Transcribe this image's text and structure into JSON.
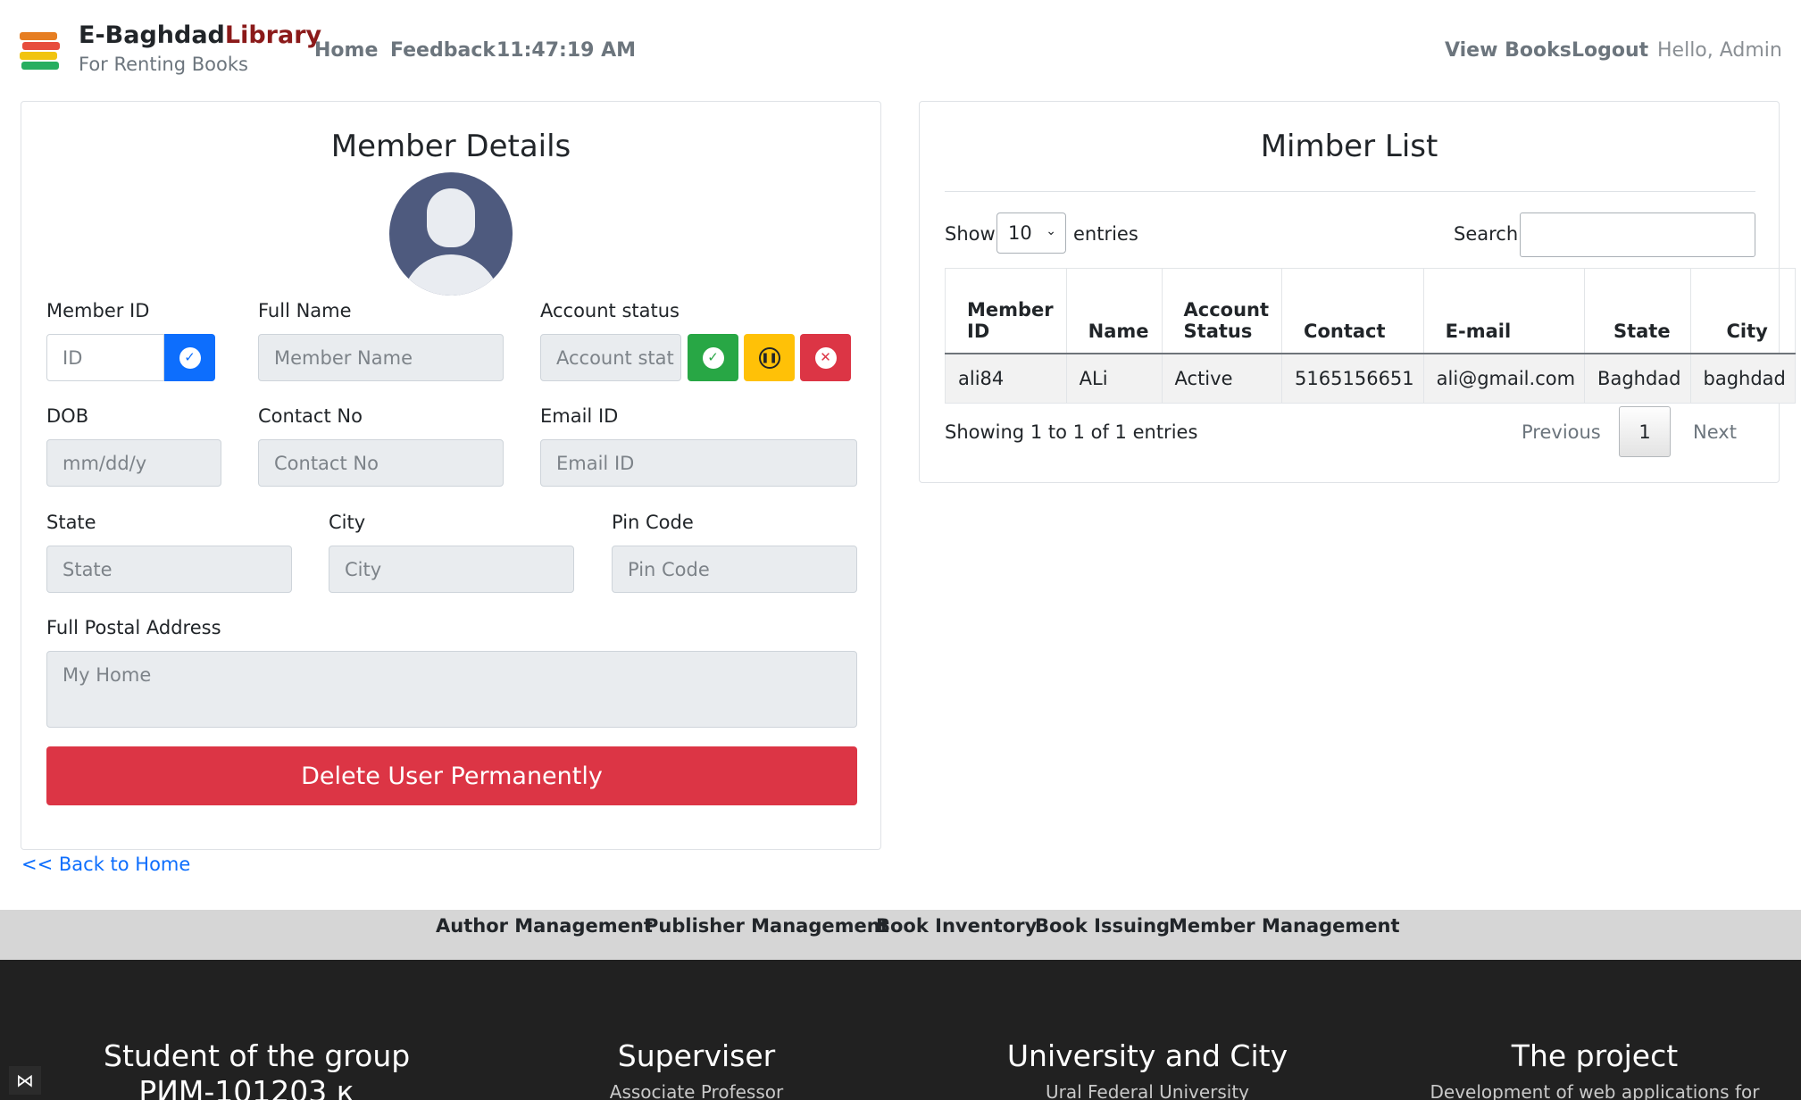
{
  "brand": {
    "name_main": "E-Baghdad",
    "name_accent": "Library",
    "tagline": "For Renting Books",
    "logo_icon": "books-stack-icon"
  },
  "nav": {
    "home": "Home",
    "feedback": "Feedback",
    "clock": "11:47:19 AM",
    "view_books": "View Books",
    "logout": "Logout",
    "greeting": "Hello, Admin"
  },
  "member_details": {
    "title": "Member Details",
    "avatar_icon": "user-avatar-icon",
    "member_id_label": "Member ID",
    "member_id_placeholder": "ID",
    "full_name_label": "Full Name",
    "full_name_placeholder": "Member Name",
    "account_status_label": "Account status",
    "account_status_placeholder": "Account stat",
    "dob_label": "DOB",
    "dob_placeholder": "mm/dd/y",
    "contact_label": "Contact No",
    "contact_placeholder": "Contact No",
    "email_label": "Email ID",
    "email_placeholder": "Email ID",
    "state_label": "State",
    "state_placeholder": "State",
    "city_label": "City",
    "city_placeholder": "City",
    "pin_label": "Pin Code",
    "pin_placeholder": "Pin Code",
    "address_label": "Full Postal Address",
    "address_placeholder": "My Home",
    "delete_button": "Delete User Permanently",
    "back_link": "<< Back to Home",
    "colors": {
      "primary": "#0d6efd",
      "success": "#28a745",
      "warning": "#ffc107",
      "danger": "#dc3545"
    }
  },
  "member_list": {
    "title": "Mimber List",
    "show_label": "Show",
    "entries_label": "entries",
    "page_size": "10",
    "search_label": "Search:",
    "columns": [
      "Member ID",
      "Name",
      "Account Status",
      "Contact",
      "E-mail",
      "State",
      "City"
    ],
    "rows": [
      [
        "ali84",
        "ALi",
        "Active",
        "5165156651",
        "ali@gmail.com",
        "Baghdad",
        "baghdad"
      ]
    ],
    "info": "Showing 1 to 1 of 1 entries",
    "previous": "Previous",
    "current_page": "1",
    "next": "Next"
  },
  "admin_bar": {
    "links": [
      "Author Management",
      "Publisher Management",
      "Book Inventory",
      "Book Issuing",
      "Member Management"
    ]
  },
  "footer": {
    "col1_title": "Student of the group",
    "col1_sub": "РИМ-101203 к",
    "col2_title": "Superviser",
    "col2_sub": "Associate Professor",
    "col3_title": "University and City",
    "col3_sub": "Ural Federal University",
    "col4_title": "The project",
    "col4_sub": "Development of web applications for"
  }
}
